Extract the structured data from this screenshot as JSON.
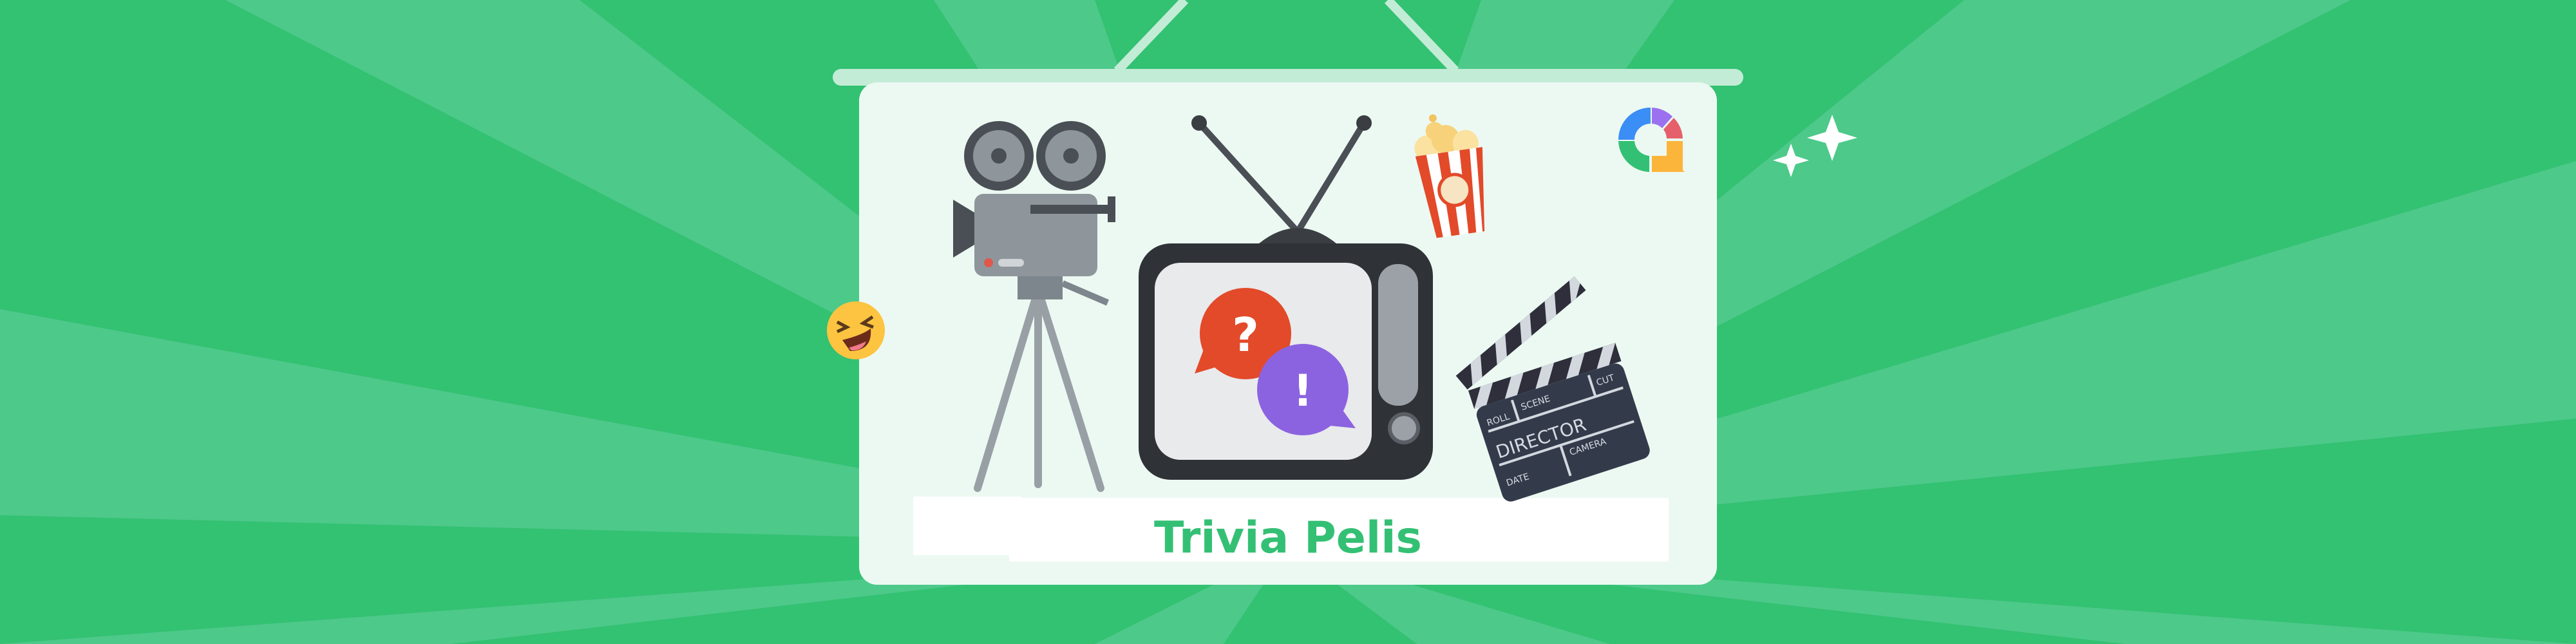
{
  "banner": {
    "title": "Trivia Pelis",
    "tv_bubbles": {
      "question": "?",
      "exclamation": "!"
    },
    "clapperboard": {
      "roll": "ROLL",
      "scene": "SCENE",
      "cut": "CUT",
      "director": "DIRECTOR",
      "date": "DATE",
      "camera": "CAMERA"
    },
    "icons": [
      "film-camera-icon",
      "tv-icon",
      "popcorn-icon",
      "clapperboard-icon",
      "laughing-emoji-icon",
      "sparkle-icon",
      "brand-logo-icon"
    ]
  },
  "colors": {
    "background": "#33c172",
    "rays": "#4dc98a",
    "board": "#ecf9f2",
    "title": "#34c074",
    "question_bubble": "#e24a2a",
    "exclamation_bubble": "#8b63e0",
    "logo": [
      "#3a8ef6",
      "#9b71ef",
      "#e5606a",
      "#fcb53b",
      "#34c074"
    ]
  }
}
